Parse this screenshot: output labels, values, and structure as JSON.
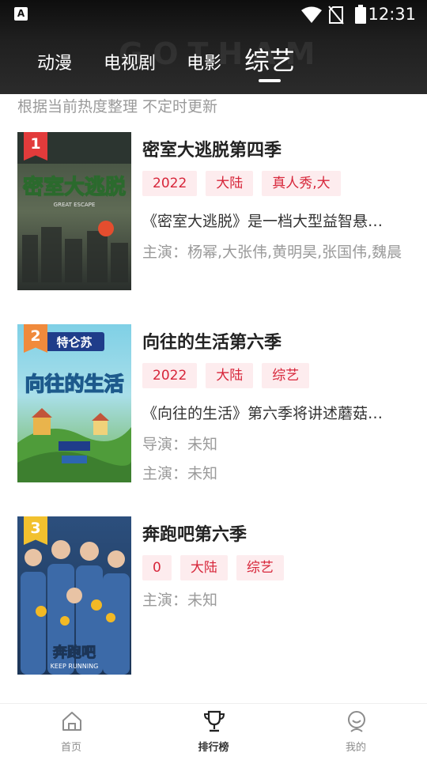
{
  "status_bar": {
    "time": "12:31",
    "app_icon_letter": "A"
  },
  "header": {
    "background_text": "GOTHAM",
    "tabs": [
      {
        "label": "动漫",
        "active": false
      },
      {
        "label": "电视剧",
        "active": false
      },
      {
        "label": "电影",
        "active": false
      },
      {
        "label": "综艺",
        "active": true
      }
    ]
  },
  "subtitle": "根据当前热度整理 不定时更新",
  "items": [
    {
      "rank": "1",
      "rank_color": "#e23b3b",
      "title": "密室大逃脱第四季",
      "tags": [
        "2022",
        "大陆",
        "真人秀,大"
      ],
      "description": "《密室大逃脱》是一档大型益智悬疑推理真人秀",
      "lines": [
        "主演：杨幂,大张伟,黄明昊,张国伟,魏晨"
      ],
      "poster": {
        "text": "密室大逃脱",
        "sub": "GREAT ESCAPE"
      }
    },
    {
      "rank": "2",
      "rank_color": "#f08a3c",
      "title": "向往的生活第六季",
      "tags": [
        "2022",
        "大陆",
        "综艺"
      ],
      "description": "《向往的生活》第六季将讲述蘑菇屋的故事",
      "lines": [
        "导演：未知",
        "主演：未知"
      ],
      "poster": {
        "text": "向往的生活",
        "sub": "特仑苏"
      }
    },
    {
      "rank": "3",
      "rank_color": "#f2c12e",
      "title": "奔跑吧第六季",
      "tags": [
        "0",
        "大陆",
        "综艺"
      ],
      "description": "",
      "lines": [
        "主演：未知"
      ],
      "poster": {
        "text": "奔跑吧",
        "sub": "KEEP RUNNING"
      }
    }
  ],
  "bottom_nav": [
    {
      "label": "首页",
      "active": false
    },
    {
      "label": "排行榜",
      "active": true
    },
    {
      "label": "我的",
      "active": false
    }
  ]
}
